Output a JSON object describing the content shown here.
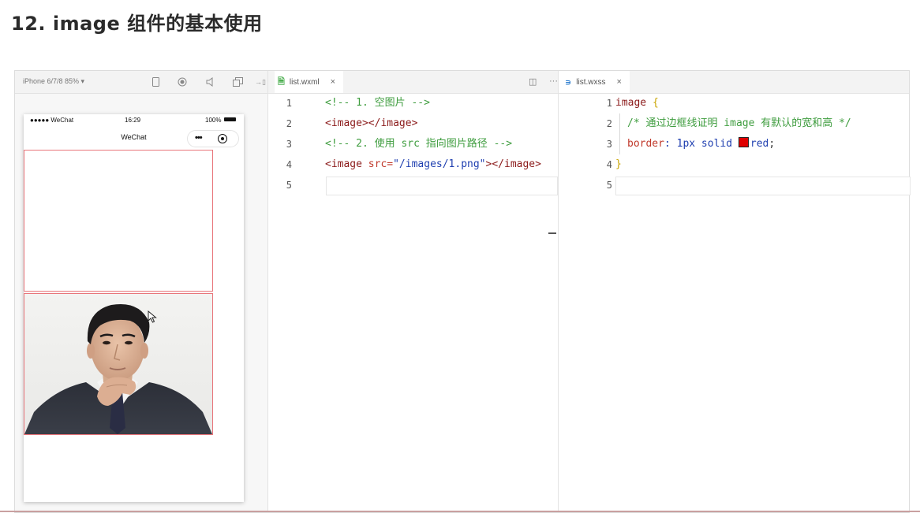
{
  "slide": {
    "title": "12. image 组件的基本使用"
  },
  "simulator": {
    "device_select": "iPhone 6/7/8 85% ▾",
    "status": {
      "carrier": "●●●●● WeChat",
      "time": "16:29",
      "battery": "100%"
    },
    "nav_title": "WeChat",
    "capsule_menu": "•••"
  },
  "wxml_editor": {
    "tab_label": "list.wxml",
    "tab_close": "×",
    "split_icon": "◫",
    "more_icon": "···",
    "lines": [
      {
        "no": "1",
        "parts": [
          "<!-- 1. 空图片 -->"
        ]
      },
      {
        "no": "2",
        "parts": [
          "<image></image>"
        ]
      },
      {
        "no": "3",
        "parts": [
          "<!-- 2. 使用 src 指向图片路径 -->"
        ]
      },
      {
        "no": "4",
        "parts": [
          "<image ",
          "src=",
          "\"/images/1.png\"",
          "></image>"
        ]
      },
      {
        "no": "5",
        "parts": [
          ""
        ]
      }
    ]
  },
  "wxss_editor": {
    "tab_label": "list.wxss",
    "tab_close": "×",
    "lines": [
      {
        "no": "1",
        "parts": [
          "image",
          " {"
        ]
      },
      {
        "no": "2",
        "parts": [
          "/* 通过边框线证明 image 有默认的宽和高 */"
        ]
      },
      {
        "no": "3",
        "parts": [
          "border",
          ": 1px solid ",
          "red",
          ";"
        ]
      },
      {
        "no": "4",
        "parts": [
          "}"
        ]
      },
      {
        "no": "5",
        "parts": [
          ""
        ]
      }
    ]
  },
  "colors": {
    "image_border": "#e8757a",
    "comment": "#3f9d3f",
    "tag": "#8b1a1a",
    "string": "#1f3fb0",
    "swatch_red": "#e00000"
  }
}
